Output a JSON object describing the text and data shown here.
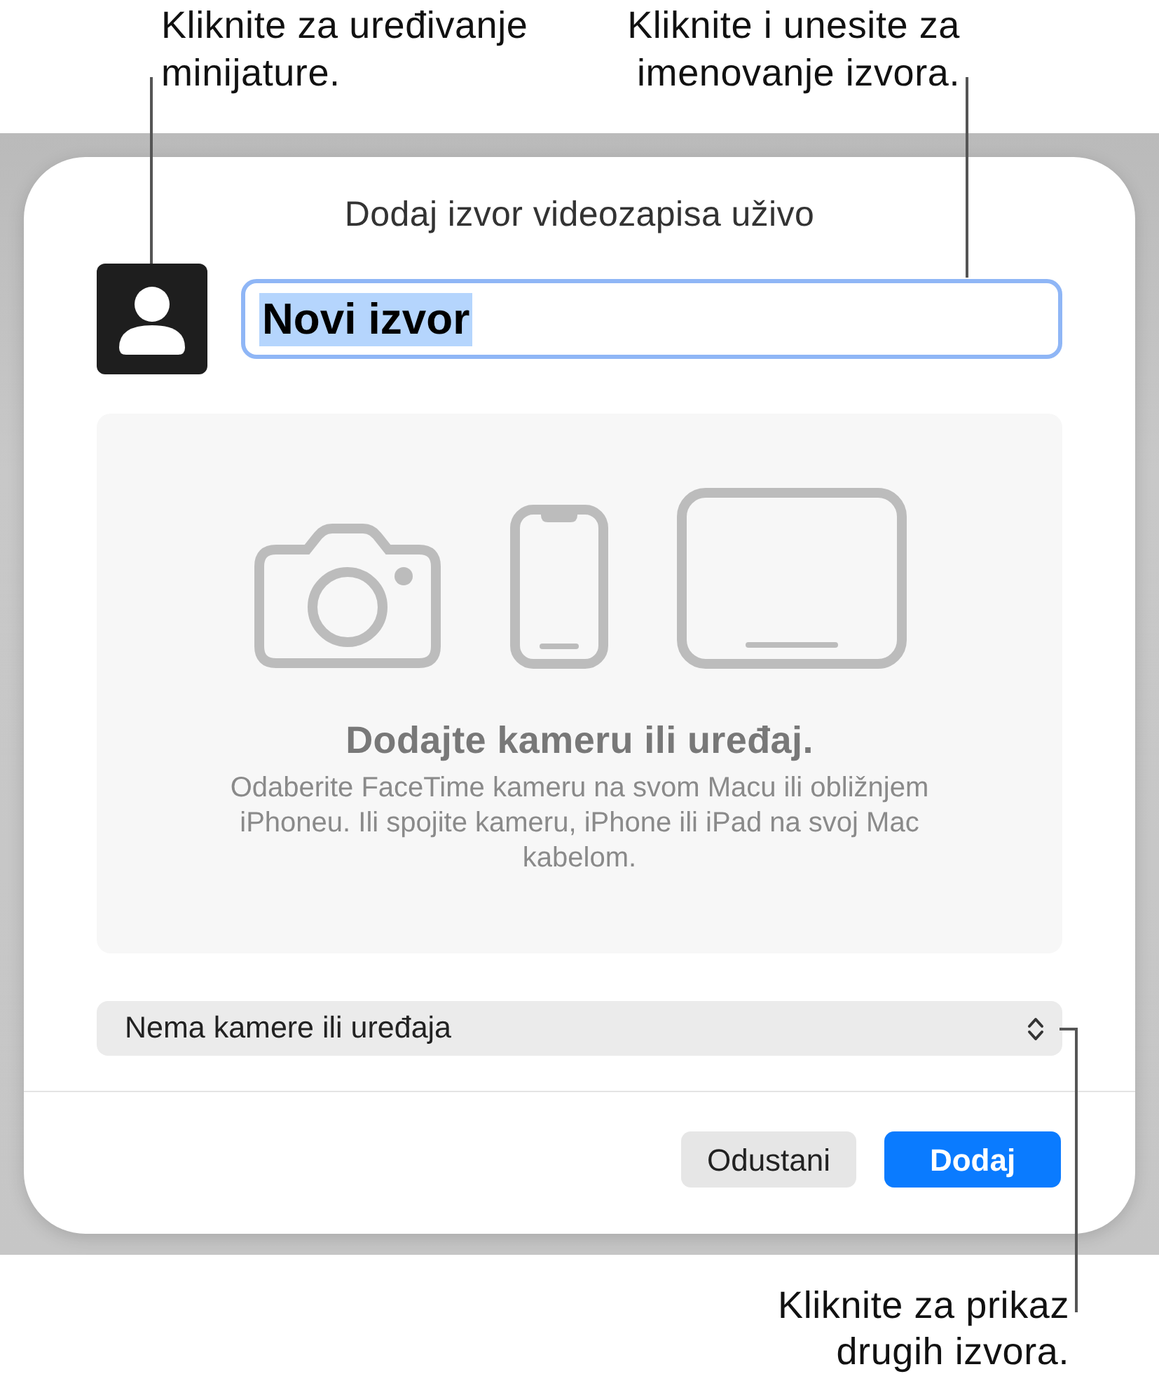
{
  "callouts": [
    {
      "text": "Kliknite za uređivanje minijature."
    },
    {
      "text": "Kliknite i unesite za imenovanje izvora."
    },
    {
      "text": "Kliknite za prikaz drugih izvora."
    }
  ],
  "dialog": {
    "title": "Dodaj izvor videozapisa uživo",
    "name_field": {
      "value": "Novi izvor",
      "focused": true,
      "text_selected": true
    },
    "empty_state": {
      "heading": "Dodajte kameru ili uređaj.",
      "text": "Odaberite FaceTime kameru na svom Macu ili obližnjem iPhoneu. Ili spojite kameru, iPhone ili iPad na svoj Mac kabelom."
    },
    "device_select": {
      "value": "Nema kamere ili uređaja"
    },
    "buttons": [
      {
        "label": "Odustani",
        "kind": "secondary"
      },
      {
        "label": "Dodaj",
        "kind": "primary"
      }
    ]
  }
}
